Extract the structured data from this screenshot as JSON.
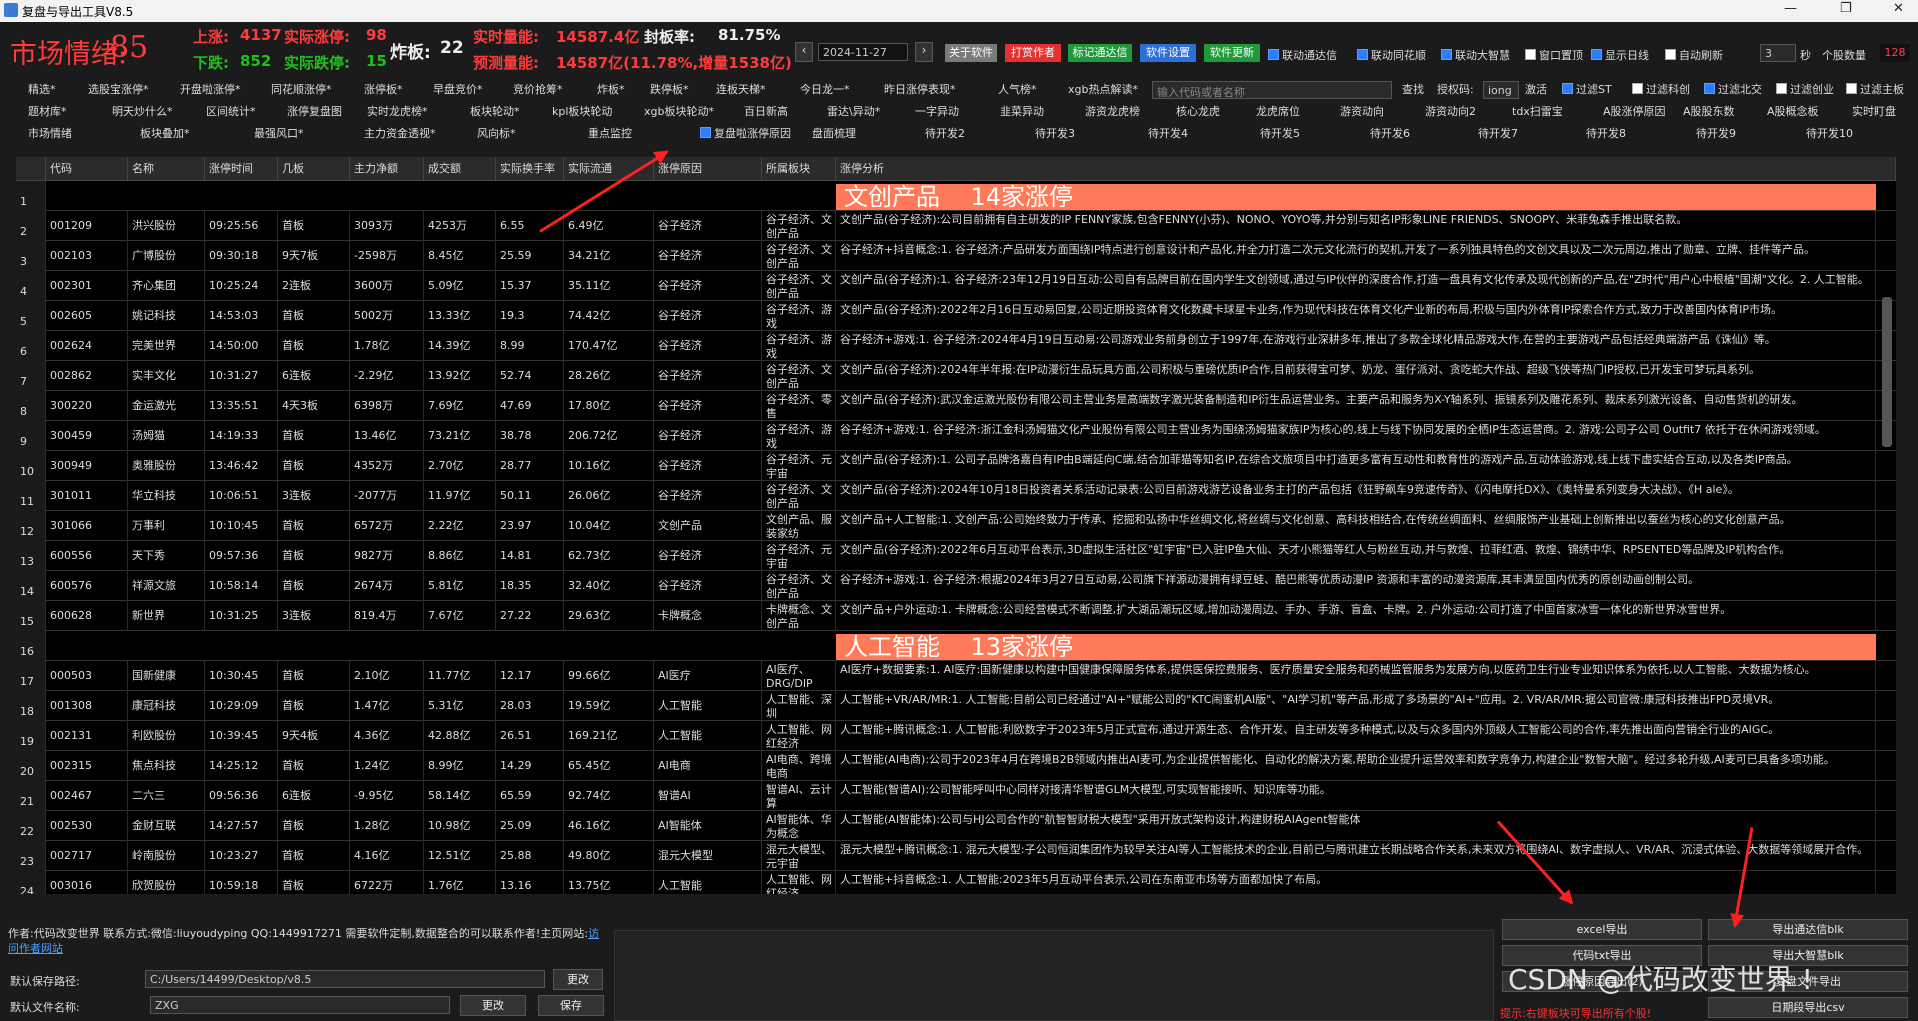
{
  "window": {
    "title": "复盘与导出工具V8.5"
  },
  "header": {
    "sentiment_label": "市场情绪:",
    "sentiment_value": "85",
    "up_label": "上涨:",
    "up_value": "4137",
    "real_up_label": "实际涨停:",
    "real_up_value": "98",
    "down_label": "下跌:",
    "down_value": "852",
    "real_down_label": "实际跌停:",
    "real_down_value": "15",
    "broken_label": "炸板:",
    "broken_value": "22",
    "real_volume_label": "实时量能:",
    "real_volume_value": "14587.4亿",
    "seal_rate_label": "封板率:",
    "seal_rate_value": "81.75%",
    "forecast_label": "预测量能:",
    "forecast_value": "14587亿(11.78%,增量1538亿)",
    "date": "2024-11-27",
    "buttons": [
      "关于软件",
      "打赏作者",
      "标记通达信",
      "软件设置",
      "软件更新"
    ],
    "checks": [
      "联动通达信",
      "联动同花顺",
      "联动大智慧",
      "窗口置顶",
      "显示日线",
      "自动刷新"
    ],
    "refresh_value": "3",
    "sec_label": "秒",
    "stock_count_label": "个股数量",
    "stock_count": "128"
  },
  "toolbar": {
    "row1": [
      "精选*",
      "选股宝涨停*",
      "开盘啦涨停*",
      "同花顺涨停*",
      "涨停板*",
      "早盘竞价*",
      "竞价抢筹*",
      "炸板*",
      "跌停板*",
      "连板天梯*",
      "今日龙一*",
      "昨日涨停表现*",
      "人气榜*",
      "xgb热点解读*"
    ],
    "search_placeholder": "输入代码或者名称",
    "search_label": "查找",
    "auth_label": "授权码:",
    "auth_value": "iong",
    "activate_label": "激活",
    "row1_checks": [
      "过滤ST",
      "过滤科创",
      "过滤北交",
      "过滤创业",
      "过滤主板"
    ],
    "row2": [
      "题材库*",
      "明天炒什么*",
      "区间统计*",
      "涨停复盘图",
      "实时龙虎榜*",
      "板块轮动*",
      "kpl板块轮动",
      "xgb板块轮动*",
      "百日新高",
      "雷达\\异动*",
      "一字异动",
      "韭菜异动",
      "游资龙虎榜",
      "核心龙虎",
      "龙虎席位",
      "游资动向",
      "游资动向2",
      "tdx扫雷宝",
      "A股涨停原因",
      "A股股东数",
      "A股概念板",
      "实时盯盘"
    ],
    "row3": [
      "市场情绪",
      "板块叠加*",
      "最强风口*",
      "主力资金透视*",
      "风向标*",
      "重点监控",
      "复盘啦涨停原因",
      "盘面梳理",
      "待开发2",
      "待开发3",
      "待开发4",
      "待开发5",
      "待开发6",
      "待开发7",
      "待开发8",
      "待开发9",
      "待开发10"
    ]
  },
  "table": {
    "columns": [
      "代码",
      "名称",
      "涨停时间",
      "几板",
      "主力净额",
      "成交额",
      "实际换手率",
      "实际流通",
      "涨停原因",
      "所属板块",
      "涨停分析"
    ],
    "banners": {
      "r1": "文创产品    14家涨停",
      "r16": "人工智能    13家涨停"
    },
    "rows": [
      {
        "n": "2",
        "code": "001209",
        "name": "洪兴股份",
        "time": "09:25:56",
        "board": "首板",
        "net": "3093万",
        "amt": "4253万",
        "turn": "6.55",
        "float": "6.49亿",
        "reason": "谷子经济",
        "sector": "谷子经济、文创产品",
        "analysis": "文创产品(谷子经济):公司目前拥有自主研发的IP FENNY家族,包含FENNY(小芬)、NONO、YOYO等,并分别与知名IP形象LINE FRIENDS、SNOOPY、米菲兔森手推出联名款。"
      },
      {
        "n": "3",
        "code": "002103",
        "name": "广博股份",
        "time": "09:30:18",
        "board": "9天7板",
        "net": "-2598万",
        "amt": "8.45亿",
        "turn": "25.59",
        "float": "34.21亿",
        "reason": "谷子经济",
        "sector": "谷子经济、文创产品",
        "analysis": "谷子经济+抖音概念:1. 谷子经济:产品研发方面围绕IP特点进行创意设计和产品化,并全力打造二次元文化流行的契机,开发了一系列独具特色的文创文具以及二次元周边,推出了勋章、立牌、挂件等产品。"
      },
      {
        "n": "4",
        "code": "002301",
        "name": "齐心集团",
        "time": "10:25:24",
        "board": "2连板",
        "net": "3600万",
        "amt": "5.09亿",
        "turn": "15.37",
        "float": "35.11亿",
        "reason": "谷子经济",
        "sector": "谷子经济、文创产品",
        "analysis": "文创产品(谷子经济):1. 谷子经济:23年12月19日互动:公司自有品牌目前在国内学生文创领域,通过与IP伙伴的深度合作,打造一盘具有文化传承及现代创新的产品,在\"Z时代\"用户心中根植\"国潮\"文化。2. 人工智能。"
      },
      {
        "n": "5",
        "code": "002605",
        "name": "姚记科技",
        "time": "14:53:03",
        "board": "首板",
        "net": "5002万",
        "amt": "13.33亿",
        "turn": "19.3",
        "float": "74.42亿",
        "reason": "谷子经济",
        "sector": "谷子经济、游戏",
        "analysis": "文创产品(谷子经济):2022年2月16日互动易回复,公司近期投资体育文化数藏卡球星卡业务,作为现代科技在体育文化产业新的布局,积极与国内外体育IP探索合作方式,致力于改善国内体育IP市场。"
      },
      {
        "n": "6",
        "code": "002624",
        "name": "完美世界",
        "time": "14:50:00",
        "board": "首板",
        "net": "1.78亿",
        "amt": "14.39亿",
        "turn": "8.99",
        "float": "170.47亿",
        "reason": "谷子经济",
        "sector": "谷子经济、游戏",
        "analysis": "谷子经济+游戏:1. 谷子经济:2024年4月19日互动易:公司游戏业务前身创立于1997年,在游戏行业深耕多年,推出了多款全球化精品游戏大作,在营的主要游戏产品包括经典端游产品《诛仙》等。"
      },
      {
        "n": "7",
        "code": "002862",
        "name": "实丰文化",
        "time": "10:31:27",
        "board": "6连板",
        "net": "-2.29亿",
        "amt": "13.92亿",
        "turn": "52.74",
        "float": "28.26亿",
        "reason": "谷子经济",
        "sector": "谷子经济、文创产品",
        "analysis": "文创产品(谷子经济):2024年半年报:在IP动漫衍生品玩具方面,公司积极与重磅优质IP合作,目前获得宝可梦、奶龙、蛋仔派对、贪吃蛇大作战、超级飞侠等热门IP授权,已开发宝可梦玩具系列。"
      },
      {
        "n": "8",
        "code": "300220",
        "name": "金运激光",
        "time": "13:35:51",
        "board": "4天3板",
        "net": "6398万",
        "amt": "7.69亿",
        "turn": "47.69",
        "float": "17.80亿",
        "reason": "谷子经济",
        "sector": "谷子经济、零售",
        "analysis": "文创产品(谷子经济):武汉金运激光股份有限公司主营业务是高端数字激光装备制造和IP衍生品运营业务。主要产品和服务为X-Y轴系列、振镜系列及雕花系列、裁床系列激光设备、自动售货机的研发。"
      },
      {
        "n": "9",
        "code": "300459",
        "name": "汤姆猫",
        "time": "14:19:33",
        "board": "首板",
        "net": "13.46亿",
        "amt": "73.21亿",
        "turn": "38.78",
        "float": "206.72亿",
        "reason": "谷子经济",
        "sector": "谷子经济、游戏",
        "analysis": "谷子经济+游戏:1. 谷子经济:浙江金科汤姆猫文化产业股份有限公司主营业务为围绕汤姆猫家族IP为核心的,线上与线下协同发展的全栖IP生态运营商。2. 游戏:公司子公司 Outfit7 依托于在休闲游戏领域。"
      },
      {
        "n": "10",
        "code": "300949",
        "name": "奥雅股份",
        "time": "13:46:42",
        "board": "首板",
        "net": "4352万",
        "amt": "2.70亿",
        "turn": "28.77",
        "float": "10.16亿",
        "reason": "谷子经济",
        "sector": "谷子经济、元宇宙",
        "analysis": "文创产品(谷子经济):1. 公司子品牌洛嘉自有IP由B端延向C端,结合加菲猫等知名IP,在综合文旅项目中打造更多富有互动性和教育性的游戏产品,互动体验游戏,线上线下虚实结合互动,以及各类IP商品。"
      },
      {
        "n": "11",
        "code": "301011",
        "name": "华立科技",
        "time": "10:06:51",
        "board": "3连板",
        "net": "-2077万",
        "amt": "11.97亿",
        "turn": "50.11",
        "float": "26.06亿",
        "reason": "谷子经济",
        "sector": "谷子经济、文创产品",
        "analysis": "文创产品(谷子经济):2024年10月18日投资者关系活动记录表:公司目前游戏游艺设备业务主打的产品包括《狂野飙车9竞速传奇》、《闪电摩托DX》、《奥特曼系列变身大决战》、《H ale》。"
      },
      {
        "n": "12",
        "code": "301066",
        "name": "万事利",
        "time": "10:10:45",
        "board": "首板",
        "net": "6572万",
        "amt": "2.22亿",
        "turn": "23.97",
        "float": "10.04亿",
        "reason": "文创产品",
        "sector": "文创产品、服装家纺",
        "analysis": "文创产品+人工智能:1. 文创产品:公司始终致力于传承、挖掘和弘扬中华丝绸文化,将丝绸与文化创意、高科技相结合,在传统丝绸面料、丝绸服饰产业基础上创新推出以蚕丝为核心的文化创意产品。"
      },
      {
        "n": "13",
        "code": "600556",
        "name": "天下秀",
        "time": "09:57:36",
        "board": "首板",
        "net": "9827万",
        "amt": "8.86亿",
        "turn": "14.81",
        "float": "62.73亿",
        "reason": "谷子经济",
        "sector": "谷子经济、元宇宙",
        "analysis": "文创产品(谷子经济):2022年6月互动平台表示,3D虚拟生活社区\"虹宇宙\"已入驻IP鱼大仙、天才小熊猫等红人与粉丝互动,并与敦煌、拉菲红酒、敦煌、锦绣中华、RPSENTED等品牌及IP机构合作。"
      },
      {
        "n": "14",
        "code": "600576",
        "name": "祥源文旅",
        "time": "10:58:14",
        "board": "首板",
        "net": "2674万",
        "amt": "5.81亿",
        "turn": "18.35",
        "float": "32.40亿",
        "reason": "谷子经济",
        "sector": "谷子经济、文创产品",
        "analysis": "谷子经济+游戏:1. 谷子经济:根据2024年3月27日互动易,公司旗下祥源动漫拥有绿豆蛙、酷巴熊等优质动漫IP 资源和丰富的动漫资源库,其丰满显国内优秀的原创动画创制公司。"
      },
      {
        "n": "15",
        "code": "600628",
        "name": "新世界",
        "time": "10:31:25",
        "board": "3连板",
        "net": "819.4万",
        "amt": "7.67亿",
        "turn": "27.22",
        "float": "29.63亿",
        "reason": "卡牌概念",
        "sector": "卡牌概念、文创产品",
        "analysis": "文创产品+户外运动:1. 卡牌概念:公司经营模式不断调整,扩大湖品潮玩区域,增加动漫周边、手办、手游、盲盒、卡牌。2. 户外运动:公司打造了中国首家冰雪一体化的新世界冰雪世界。"
      },
      {
        "n": "17",
        "code": "000503",
        "name": "国新健康",
        "time": "10:30:45",
        "board": "首板",
        "net": "2.10亿",
        "amt": "11.77亿",
        "turn": "12.17",
        "float": "99.66亿",
        "reason": "AI医疗",
        "sector": "AI医疗、DRG/DIP",
        "analysis": "AI医疗+数据要素:1. AI医疗:国新健康以构建中国健康保障服务体系,提供医保控费服务、医疗质量安全服务和药械监管服务为发展方向,以医药卫生行业专业知识体系为依托,以人工智能、大数据为核心。"
      },
      {
        "n": "18",
        "code": "001308",
        "name": "康冠科技",
        "time": "10:29:09",
        "board": "首板",
        "net": "1.47亿",
        "amt": "5.31亿",
        "turn": "28.03",
        "float": "19.59亿",
        "reason": "人工智能",
        "sector": "人工智能、深圳",
        "analysis": "人工智能+VR/AR/MR:1. 人工智能:目前公司已经通过\"AI+\"赋能公司的\"KTC闹蜜机AI版\"、\"AI学习机\"等产品,形成了多场景的\"AI+\"应用。2. VR/AR/MR:据公司官微:康冠科技推出FPD灵境VR。"
      },
      {
        "n": "19",
        "code": "002131",
        "name": "利欧股份",
        "time": "10:39:45",
        "board": "9天4板",
        "net": "4.36亿",
        "amt": "42.88亿",
        "turn": "26.51",
        "float": "169.21亿",
        "reason": "人工智能",
        "sector": "人工智能、网红经济",
        "analysis": "人工智能+腾讯概念:1. 人工智能:利欧数字于2023年5月正式宣布,通过开源生态、合作开发、自主研发等多种模式,以及与众多国内外顶级人工智能公司的合作,率先推出面向营销全行业的AIGC。"
      },
      {
        "n": "20",
        "code": "002315",
        "name": "焦点科技",
        "time": "14:25:12",
        "board": "首板",
        "net": "1.24亿",
        "amt": "8.99亿",
        "turn": "14.29",
        "float": "65.45亿",
        "reason": "AI电商",
        "sector": "AI电商、跨境电商",
        "analysis": "人工智能(AI电商):公司于2023年4月在跨境B2B领域内推出AI麦可,为企业提供智能化、自动化的解决方案,帮助企业提升运营效率和数字竞争力,构建企业\"数智大脑\"。经过多轮升级,AI麦可已具备多项功能。"
      },
      {
        "n": "21",
        "code": "002467",
        "name": "二六三",
        "time": "09:56:36",
        "board": "6连板",
        "net": "-9.95亿",
        "amt": "58.14亿",
        "turn": "65.59",
        "float": "92.74亿",
        "reason": "智谱AI",
        "sector": "智谱AI、云计算",
        "analysis": "人工智能(智谱AI):公司智能呼叫中心同样对接清华智谱GLM大模型,可实现智能接听、知识库等功能。"
      },
      {
        "n": "22",
        "code": "002530",
        "name": "金财互联",
        "time": "14:27:57",
        "board": "首板",
        "net": "1.28亿",
        "amt": "10.98亿",
        "turn": "25.09",
        "float": "46.16亿",
        "reason": "AI智能体",
        "sector": "AI智能体、华为概念",
        "analysis": "人工智能(AI智能体):公司与HJ公司合作的\"航智智财税大模型\"采用开放式架构设计,构建财税AIAgent智能体"
      },
      {
        "n": "23",
        "code": "002717",
        "name": "岭南股份",
        "time": "10:23:27",
        "board": "首板",
        "net": "4.16亿",
        "amt": "12.51亿",
        "turn": "25.88",
        "float": "49.80亿",
        "reason": "混元大模型",
        "sector": "混元大模型、元宇宙",
        "analysis": "混元大模型+腾讯概念:1. 混元大模型:子公司恒润集团作为较早关注AI等人工智能技术的企业,目前已与腾讯建立长期战略合作关系,未来双方将围绕AI、数字虚拟人、VR/AR、沉浸式体验、大数据等领域展开合作。"
      },
      {
        "n": "24",
        "code": "003016",
        "name": "欣贺股份",
        "time": "10:59:18",
        "board": "首板",
        "net": "6722万",
        "amt": "1.76亿",
        "turn": "13.16",
        "float": "13.75亿",
        "reason": "人工智能",
        "sector": "人工智能、网红经济",
        "analysis": "人工智能+抖音概念:1. 人工智能:2023年5月互动平台表示,公司在东南亚市场等方面都加快了布局。"
      }
    ]
  },
  "bottom": {
    "author_text": "作者:代码改变世界 联系方式:微信:liuyoudyping QQ:1449917271 需要软件定制,数据整合的可以联系作者!主页网站:",
    "link_text": "访问作者网站",
    "save_path_label": "默认保存路径:",
    "save_path_value": "C:/Users/14499/Desktop/v8.5",
    "change_label": "更改",
    "file_name_label": "默认文件名称:",
    "file_name_value": "ZXG",
    "change2_label": "更改",
    "save_label": "保存",
    "out_buttons": [
      "excel导出",
      "导出通达信blk",
      "代码txt导出",
      "导出大智慧blk",
      "涨停原因导出(2)",
      "复盘文件导出"
    ],
    "tip": "提示:右键板块可导出所有个股!",
    "daily_export": "日期段导出csv",
    "watermark": "CSDN @代码改变世界 !"
  },
  "colors": {
    "banner": "#ff7a59",
    "up": "#ff3b3b",
    "down": "#1fbf1f",
    "arrow": "#ff2020"
  }
}
